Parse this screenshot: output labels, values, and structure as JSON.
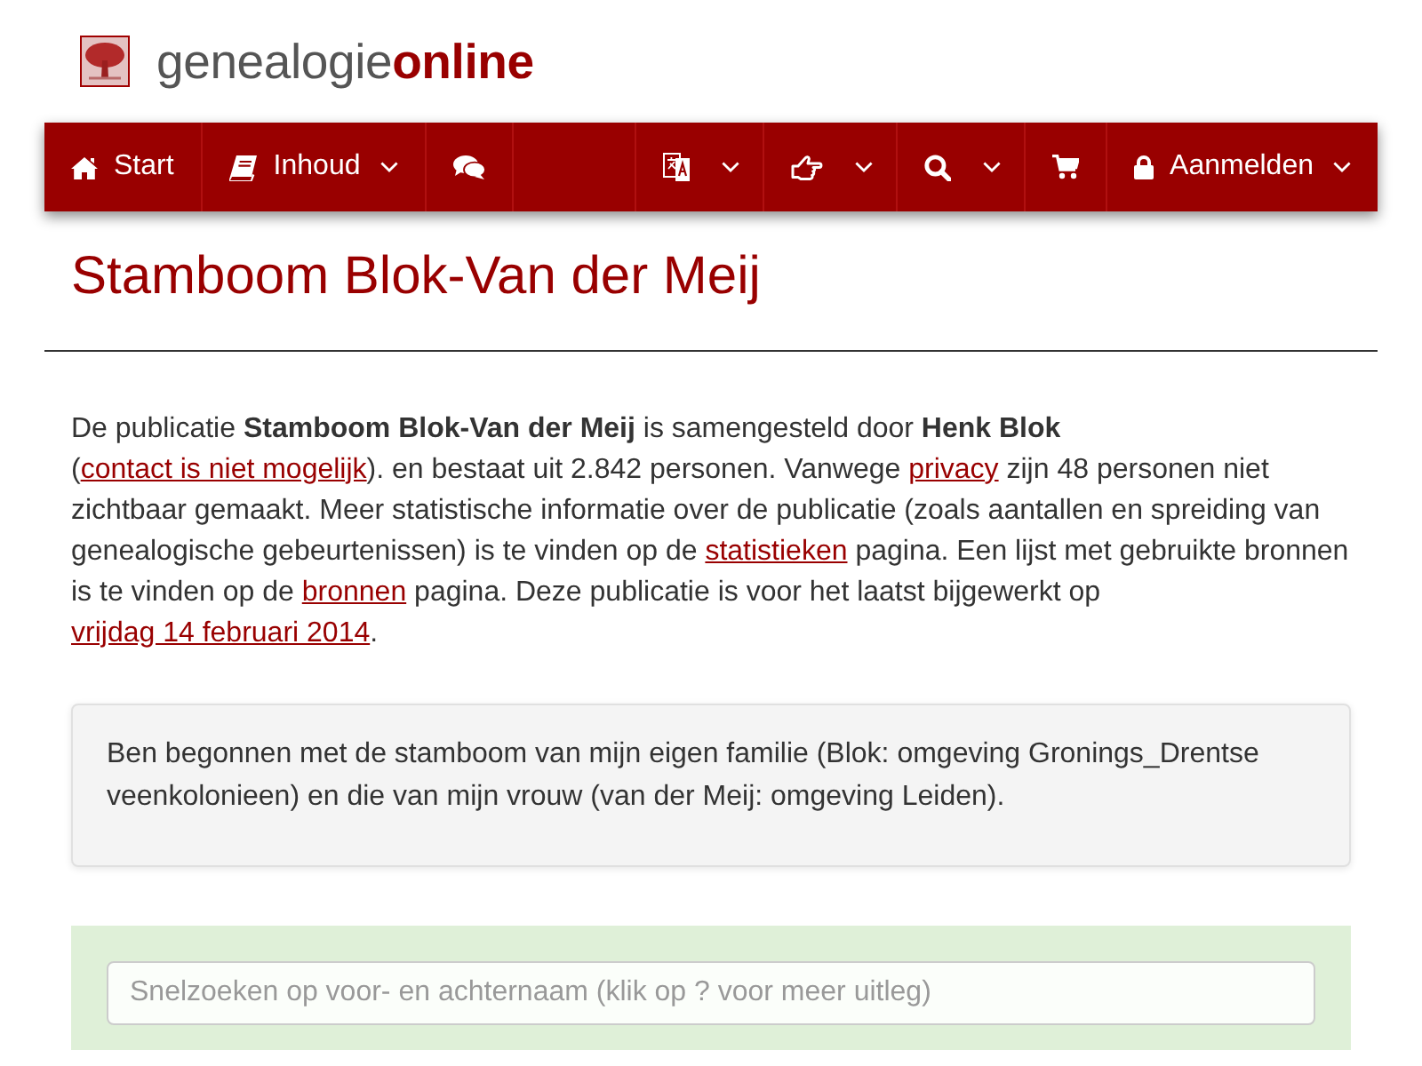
{
  "header": {
    "logo_text": "genealogie**online**"
  },
  "nav": {
    "left": [
      {
        "label": "Start",
        "dropdown": false
      },
      {
        "label": "Inhoud",
        "dropdown": true
      },
      {
        "dropdown": false
      }
    ],
    "right": [
      {
        "dropdown": true
      },
      {
        "dropdown": true
      },
      {
        "dropdown": true
      },
      {
        "dropdown": false
      },
      {
        "label": "Aanmelden",
        "dropdown": true
      }
    ]
  },
  "page_title": "Stamboom Blok-Van der Meij",
  "intro": [
    {
      "kind": "text",
      "text": "De publicatie **Stamboom Blok-Van der Meij** is samengesteld door **Henk Blok** ("
    },
    {
      "kind": "link",
      "text": "contact is niet mogelijk"
    },
    {
      "kind": "text",
      "text": "). en bestaat uit 2.842 personen. Vanwege "
    },
    {
      "kind": "link",
      "text": "privacy"
    },
    {
      "kind": "text",
      "text": " zijn 48 personen niet zichtbaar gemaakt. Meer statistische informatie over de publicatie (zoals aantallen en spreiding van genealogische gebeurtenissen) is te vinden op de "
    },
    {
      "kind": "link",
      "text": "statistieken"
    },
    {
      "kind": "text",
      "text": " pagina. Een lijst met gebruikte bronnen is te vinden op de "
    },
    {
      "kind": "link",
      "text": "bronnen"
    },
    {
      "kind": "text",
      "text": " pagina. Deze publicatie is voor het laatst bijgewerkt op "
    },
    {
      "kind": "link",
      "text": "vrijdag 14 februari 2014"
    },
    {
      "kind": "text",
      "text": "."
    }
  ],
  "description": "Ben begonnen met de stamboom van mijn eigen familie (Blok: omgeving Gronings_Drentse veenkolonieen) en die van mijn vrouw (van der Meij: omgeving Leiden).",
  "search": {
    "placeholder": "Snelzoeken op voor- en achternaam (klik op ? voor meer uitleg)"
  }
}
